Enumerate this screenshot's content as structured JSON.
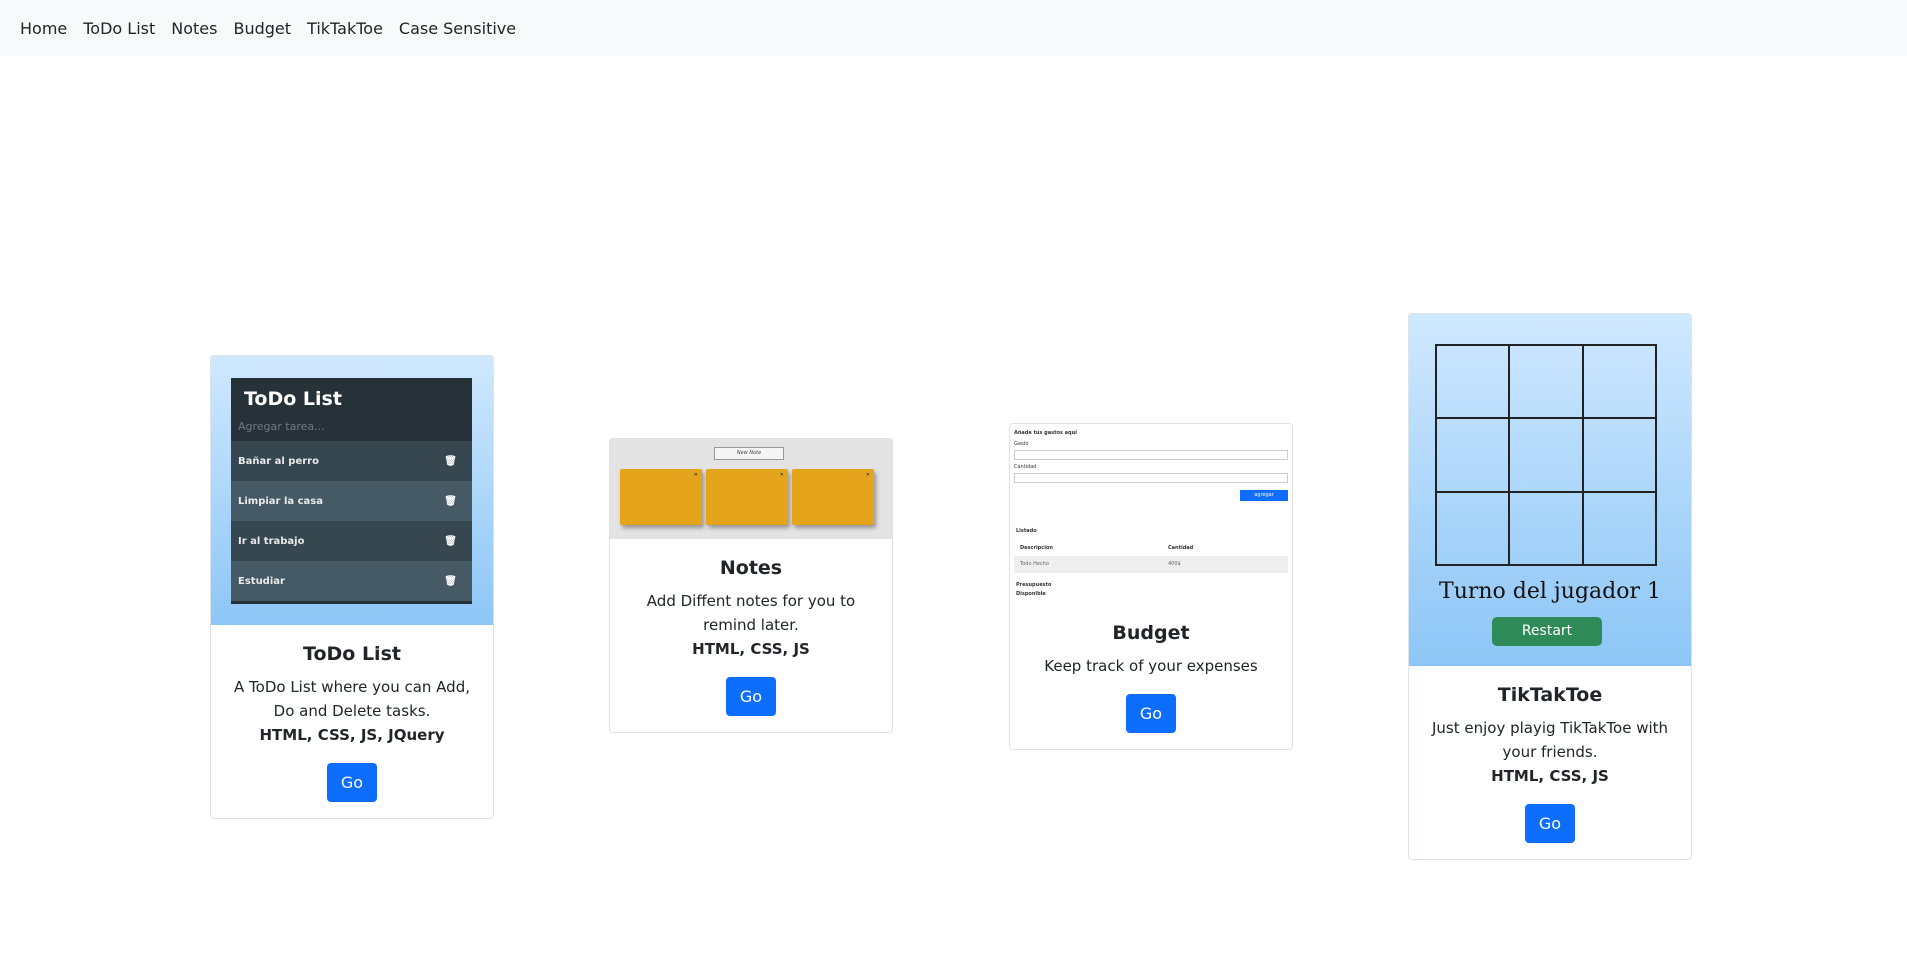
{
  "nav": {
    "items": [
      "Home",
      "ToDo List",
      "Notes",
      "Budget",
      "TikTakToe",
      "Case Sensitive"
    ]
  },
  "cards": [
    {
      "title": "ToDo List",
      "text": "A ToDo List where you can Add, Do and Delete tasks.",
      "tech": "HTML, CSS, JS, JQuery",
      "button": "Go",
      "thumb": {
        "title": "ToDo List",
        "placeholder": "Agregar tarea...",
        "tasks": [
          "Bañar al perro",
          "Limpiar la casa",
          "Ir al trabajo",
          "Estudiar"
        ]
      }
    },
    {
      "title": "Notes",
      "text": "Add Diffent notes for you to remind later.",
      "tech": "HTML, CSS, JS",
      "button": "Go",
      "thumb": {
        "header": "New Note"
      }
    },
    {
      "title": "Budget",
      "text": "Keep track of your expenses",
      "tech": "",
      "button": "Go",
      "thumb": {
        "heading": "Añade tus gastos aquí",
        "field1": "Gasto",
        "field2": "Cantidad",
        "add": "agregar",
        "list_title": "Listado",
        "col1": "Descripcion",
        "col2": "Cantidad",
        "row_desc": "Todo Hecho",
        "row_amt": "400$",
        "foot1": "Presupuesto",
        "foot2": "Disponible"
      }
    },
    {
      "title": "TikTakToe",
      "text": "Just enjoy playig TikTakToe with your friends.",
      "tech": "HTML, CSS, JS",
      "button": "Go",
      "thumb": {
        "turn": "Turno del jugador 1",
        "restart": "Restart"
      }
    }
  ],
  "colors": {
    "primary": "#0d6efd",
    "navbar_bg": "#f8f9fa",
    "restart": "#2e8b57"
  }
}
